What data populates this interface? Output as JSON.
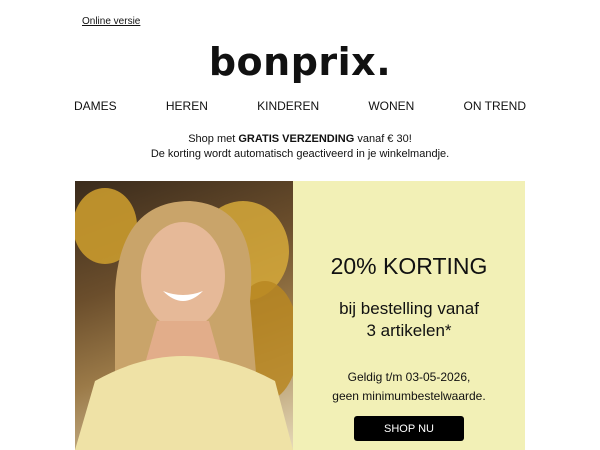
{
  "header": {
    "online_link": "Online versie",
    "logo": "bonprix."
  },
  "nav": [
    "DAMES",
    "HEREN",
    "KINDEREN",
    "WONEN",
    "ON TREND"
  ],
  "shipping": {
    "prefix": "Shop met ",
    "bold": "GRATIS VERZENDING",
    "suffix": " vanaf € 30!",
    "line2": "De korting wordt automatisch geactiveerd in je winkelmandje."
  },
  "promo": {
    "title": "20% KORTING",
    "sub_line1": "bij bestelling vanaf",
    "sub_line2": "3 artikelen*",
    "valid_line1": "Geldig t/m 03-05-2026,",
    "valid_line2": "geen minimumbestelwaarde.",
    "cta": "SHOP NU"
  },
  "colors": {
    "promo_bg": "#f2f0b6",
    "button_bg": "#000000"
  }
}
